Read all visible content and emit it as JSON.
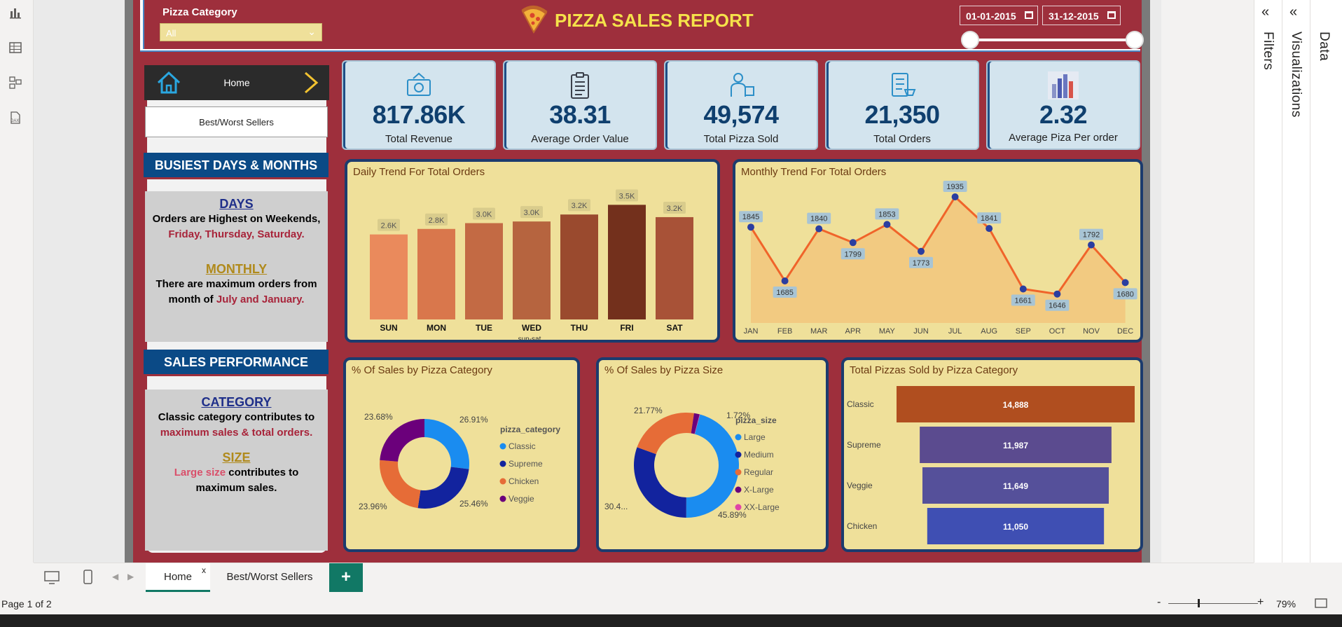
{
  "header": {
    "filter_label": "Pizza Category",
    "filter_value": "All",
    "title": "PIZZA SALES REPORT",
    "date_start": "01-01-2015",
    "date_end": "31-12-2015"
  },
  "nav": {
    "home_label": "Home",
    "bw_button": "Best/Worst Sellers"
  },
  "insights": {
    "busiest_head": "BUSIEST DAYS & MONTHS",
    "days_head": "DAYS",
    "days_line1": "Orders are Highest on Weekends",
    "days_comma": ",",
    "days_line2": "Friday, Thursday, Saturday.",
    "monthly_head": "MONTHLY",
    "monthly_line1": "There are maximum orders from",
    "monthly_line2a": "month of ",
    "monthly_line2b": "July and January.",
    "sales_head": "SALES PERFORMANCE",
    "category_head": "CATEGORY",
    "category_line1": "Classic category contributes to",
    "category_line2": "maximum sales & total orders.",
    "size_head": "SIZE",
    "size_line1a": "Large size",
    "size_line1b": " contributes to",
    "size_line2": "maximum sales."
  },
  "kpis": [
    {
      "value": "817.86K",
      "label": "Total Revenue",
      "icon": "money-icon"
    },
    {
      "value": "38.31",
      "label": "Average Order Value",
      "icon": "clipboard-icon"
    },
    {
      "value": "49,574",
      "label": "Total Pizza Sold",
      "icon": "delivery-icon"
    },
    {
      "value": "21,350",
      "label": "Total Orders",
      "icon": "order-list-icon"
    },
    {
      "value": "2.32",
      "label": "Average Piza Per order",
      "icon": "bar-chart-icon"
    }
  ],
  "chart_data": [
    {
      "type": "bar",
      "title": "Daily Trend For Total Orders",
      "xlabel": "sun-sat",
      "categories": [
        "SUN",
        "MON",
        "TUE",
        "WED",
        "THU",
        "FRI",
        "SAT"
      ],
      "values": [
        2624,
        2794,
        2973,
        3024,
        3239,
        3538,
        3158
      ],
      "data_labels": [
        "2.6K",
        "2.8K",
        "3.0K",
        "3.0K",
        "3.2K",
        "3.5K",
        "3.2K"
      ],
      "colors": [
        "#ea8a5c",
        "#d9774c",
        "#c36a44",
        "#b6643f",
        "#9a4a2e",
        "#73301c",
        "#a85237"
      ],
      "ylim": [
        0,
        4000
      ]
    },
    {
      "type": "area",
      "title": "Monthly Trend For Total Orders",
      "categories": [
        "JAN",
        "FEB",
        "MAR",
        "APR",
        "MAY",
        "JUN",
        "JUL",
        "AUG",
        "SEP",
        "OCT",
        "NOV",
        "DEC"
      ],
      "values": [
        1845,
        1685,
        1840,
        1799,
        1853,
        1773,
        1935,
        1841,
        1661,
        1646,
        1792,
        1680
      ],
      "ylim": [
        1560,
        1960
      ]
    },
    {
      "type": "pie",
      "title": "% Of Sales by Pizza Category",
      "legend_title": "pizza_category",
      "labels": [
        "Classic",
        "Supreme",
        "Chicken",
        "Veggie"
      ],
      "values": [
        26.91,
        25.46,
        23.96,
        23.68
      ],
      "value_labels": [
        "26.91%",
        "25.46%",
        "23.96%",
        "23.68%"
      ],
      "colors": [
        "#1a8cf0",
        "#12239e",
        "#e66c37",
        "#6b007b"
      ]
    },
    {
      "type": "pie",
      "title": "% Of Sales by Pizza Size",
      "legend_title": "pizza_size",
      "labels": [
        "Large",
        "Medium",
        "Regular",
        "X-Large",
        "XX-Large"
      ],
      "values": [
        45.89,
        30.49,
        21.77,
        1.72,
        0.12
      ],
      "value_labels": [
        "45.89%",
        "30.4...",
        "21.77%",
        "1.72%",
        ""
      ],
      "colors": [
        "#1a8cf0",
        "#12239e",
        "#e66c37",
        "#6b007b",
        "#e044a7"
      ]
    },
    {
      "type": "bar",
      "orientation": "horizontal-funnel",
      "title": "Total Pizzas Sold by Pizza Category",
      "categories": [
        "Classic",
        "Supreme",
        "Veggie",
        "Chicken"
      ],
      "values": [
        14888,
        11987,
        11649,
        11050
      ],
      "data_labels": [
        "14,888",
        "11,987",
        "11,649",
        "11,050"
      ],
      "colors": [
        "#b04e1f",
        "#5b4b8f",
        "#55509a",
        "#3f4fb3"
      ]
    }
  ],
  "tabs": {
    "home": "Home",
    "home_close": "x",
    "bw": "Best/Worst Sellers",
    "add": "+"
  },
  "status": {
    "page": "Page 1 of 2",
    "zoom": "79%",
    "zoom_minus": "-",
    "zoom_plus": "+"
  },
  "panes": {
    "filters": "Filters",
    "visualizations": "Visualizations",
    "data": "Data"
  }
}
